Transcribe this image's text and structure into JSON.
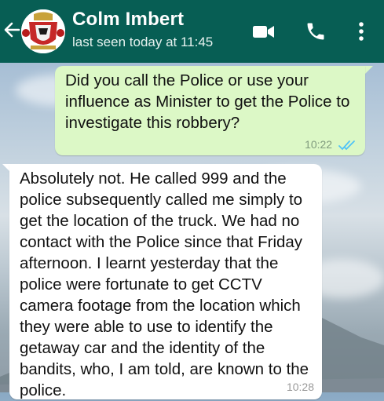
{
  "header": {
    "contact_name": "Colm Imbert",
    "status": "last seen today at 11:45",
    "icons": [
      "back-arrow-icon",
      "contact-avatar",
      "video-call-icon",
      "phone-call-icon",
      "more-options-icon"
    ],
    "color": "#075e54"
  },
  "messages": [
    {
      "direction": "outgoing",
      "text": "Did you call the Police or use your influence as Minister to get the Police to investigate this robbery?",
      "time": "10:22",
      "status": "read",
      "bubble_color": "#dcf8c6",
      "tick_color": "#4fc3f7"
    },
    {
      "direction": "incoming",
      "text": "Absolutely not. He called 999 and the police subsequently called me simply to get the location of the truck. We had no contact with the Police since that Friday afternoon. I learnt yesterday that the police were fortunate to get CCTV camera footage from the location which they were able to use to identify the getaway car and the identity of the bandits, who, I am told, are known to the police.",
      "time": "10:28",
      "bubble_color": "#ffffff"
    }
  ]
}
